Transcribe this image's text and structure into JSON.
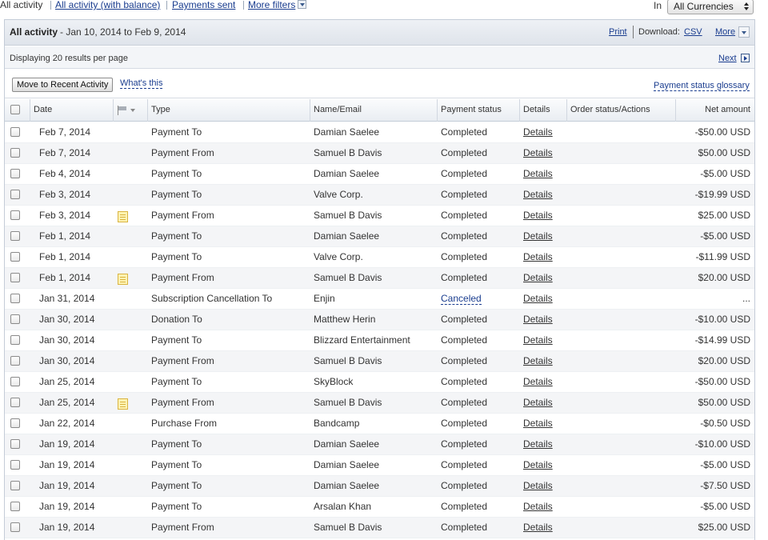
{
  "filters": {
    "tabs": [
      "All activity",
      "All activity (with balance)",
      "Payments sent",
      "More filters"
    ],
    "currency_label": "In",
    "currency_value": "All Currencies"
  },
  "header": {
    "title": "All activity",
    "date_range": "- Jan 10, 2014 to Feb 9, 2014",
    "print": "Print",
    "download_label": "Download:",
    "csv": "CSV",
    "more": "More"
  },
  "paging": {
    "display_text": "Displaying 20 results per page",
    "next": "Next"
  },
  "actions": {
    "move_button": "Move to Recent Activity",
    "whats_this": "What's this",
    "glossary": "Payment status glossary"
  },
  "columns": {
    "date": "Date",
    "type": "Type",
    "name": "Name/Email",
    "status": "Payment status",
    "details": "Details",
    "order": "Order status/Actions",
    "amount": "Net amount"
  },
  "rows": [
    {
      "date": "Feb 7, 2014",
      "note": false,
      "type": "Payment To",
      "name": "Damian Saelee",
      "status": "Completed",
      "details": "Details",
      "amount": "-$50.00 USD"
    },
    {
      "date": "Feb 7, 2014",
      "note": false,
      "type": "Payment From",
      "name": "Samuel B Davis",
      "status": "Completed",
      "details": "Details",
      "amount": "$50.00 USD"
    },
    {
      "date": "Feb 4, 2014",
      "note": false,
      "type": "Payment To",
      "name": "Damian Saelee",
      "status": "Completed",
      "details": "Details",
      "amount": "-$5.00 USD"
    },
    {
      "date": "Feb 3, 2014",
      "note": false,
      "type": "Payment To",
      "name": "Valve Corp.",
      "status": "Completed",
      "details": "Details",
      "amount": "-$19.99 USD"
    },
    {
      "date": "Feb 3, 2014",
      "note": true,
      "type": "Payment From",
      "name": "Samuel B Davis",
      "status": "Completed",
      "details": "Details",
      "amount": "$25.00 USD"
    },
    {
      "date": "Feb 1, 2014",
      "note": false,
      "type": "Payment To",
      "name": "Damian Saelee",
      "status": "Completed",
      "details": "Details",
      "amount": "-$5.00 USD"
    },
    {
      "date": "Feb 1, 2014",
      "note": false,
      "type": "Payment To",
      "name": "Valve Corp.",
      "status": "Completed",
      "details": "Details",
      "amount": "-$11.99 USD"
    },
    {
      "date": "Feb 1, 2014",
      "note": true,
      "type": "Payment From",
      "name": "Samuel B Davis",
      "status": "Completed",
      "details": "Details",
      "amount": "$20.00 USD"
    },
    {
      "date": "Jan 31, 2014",
      "note": false,
      "type": "Subscription Cancellation To",
      "name": "Enjin",
      "status": "Canceled",
      "details": "Details",
      "amount": "..."
    },
    {
      "date": "Jan 30, 2014",
      "note": false,
      "type": "Donation To",
      "name": "Matthew Herin",
      "status": "Completed",
      "details": "Details",
      "amount": "-$10.00 USD"
    },
    {
      "date": "Jan 30, 2014",
      "note": false,
      "type": "Payment To",
      "name": "Blizzard Entertainment",
      "status": "Completed",
      "details": "Details",
      "amount": "-$14.99 USD"
    },
    {
      "date": "Jan 30, 2014",
      "note": false,
      "type": "Payment From",
      "name": "Samuel B Davis",
      "status": "Completed",
      "details": "Details",
      "amount": "$20.00 USD"
    },
    {
      "date": "Jan 25, 2014",
      "note": false,
      "type": "Payment To",
      "name": "SkyBlock",
      "status": "Completed",
      "details": "Details",
      "amount": "-$50.00 USD"
    },
    {
      "date": "Jan 25, 2014",
      "note": true,
      "type": "Payment From",
      "name": "Samuel B Davis",
      "status": "Completed",
      "details": "Details",
      "amount": "$50.00 USD"
    },
    {
      "date": "Jan 22, 2014",
      "note": false,
      "type": "Purchase From",
      "name": "Bandcamp",
      "status": "Completed",
      "details": "Details",
      "amount": "-$0.50 USD"
    },
    {
      "date": "Jan 19, 2014",
      "note": false,
      "type": "Payment To",
      "name": "Damian Saelee",
      "status": "Completed",
      "details": "Details",
      "amount": "-$10.00 USD"
    },
    {
      "date": "Jan 19, 2014",
      "note": false,
      "type": "Payment To",
      "name": "Damian Saelee",
      "status": "Completed",
      "details": "Details",
      "amount": "-$5.00 USD"
    },
    {
      "date": "Jan 19, 2014",
      "note": false,
      "type": "Payment To",
      "name": "Damian Saelee",
      "status": "Completed",
      "details": "Details",
      "amount": "-$7.50 USD"
    },
    {
      "date": "Jan 19, 2014",
      "note": false,
      "type": "Payment To",
      "name": "Arsalan Khan",
      "status": "Completed",
      "details": "Details",
      "amount": "-$5.00 USD"
    },
    {
      "date": "Jan 19, 2014",
      "note": false,
      "type": "Payment From",
      "name": "Samuel B Davis",
      "status": "Completed",
      "details": "Details",
      "amount": "$25.00 USD"
    }
  ]
}
